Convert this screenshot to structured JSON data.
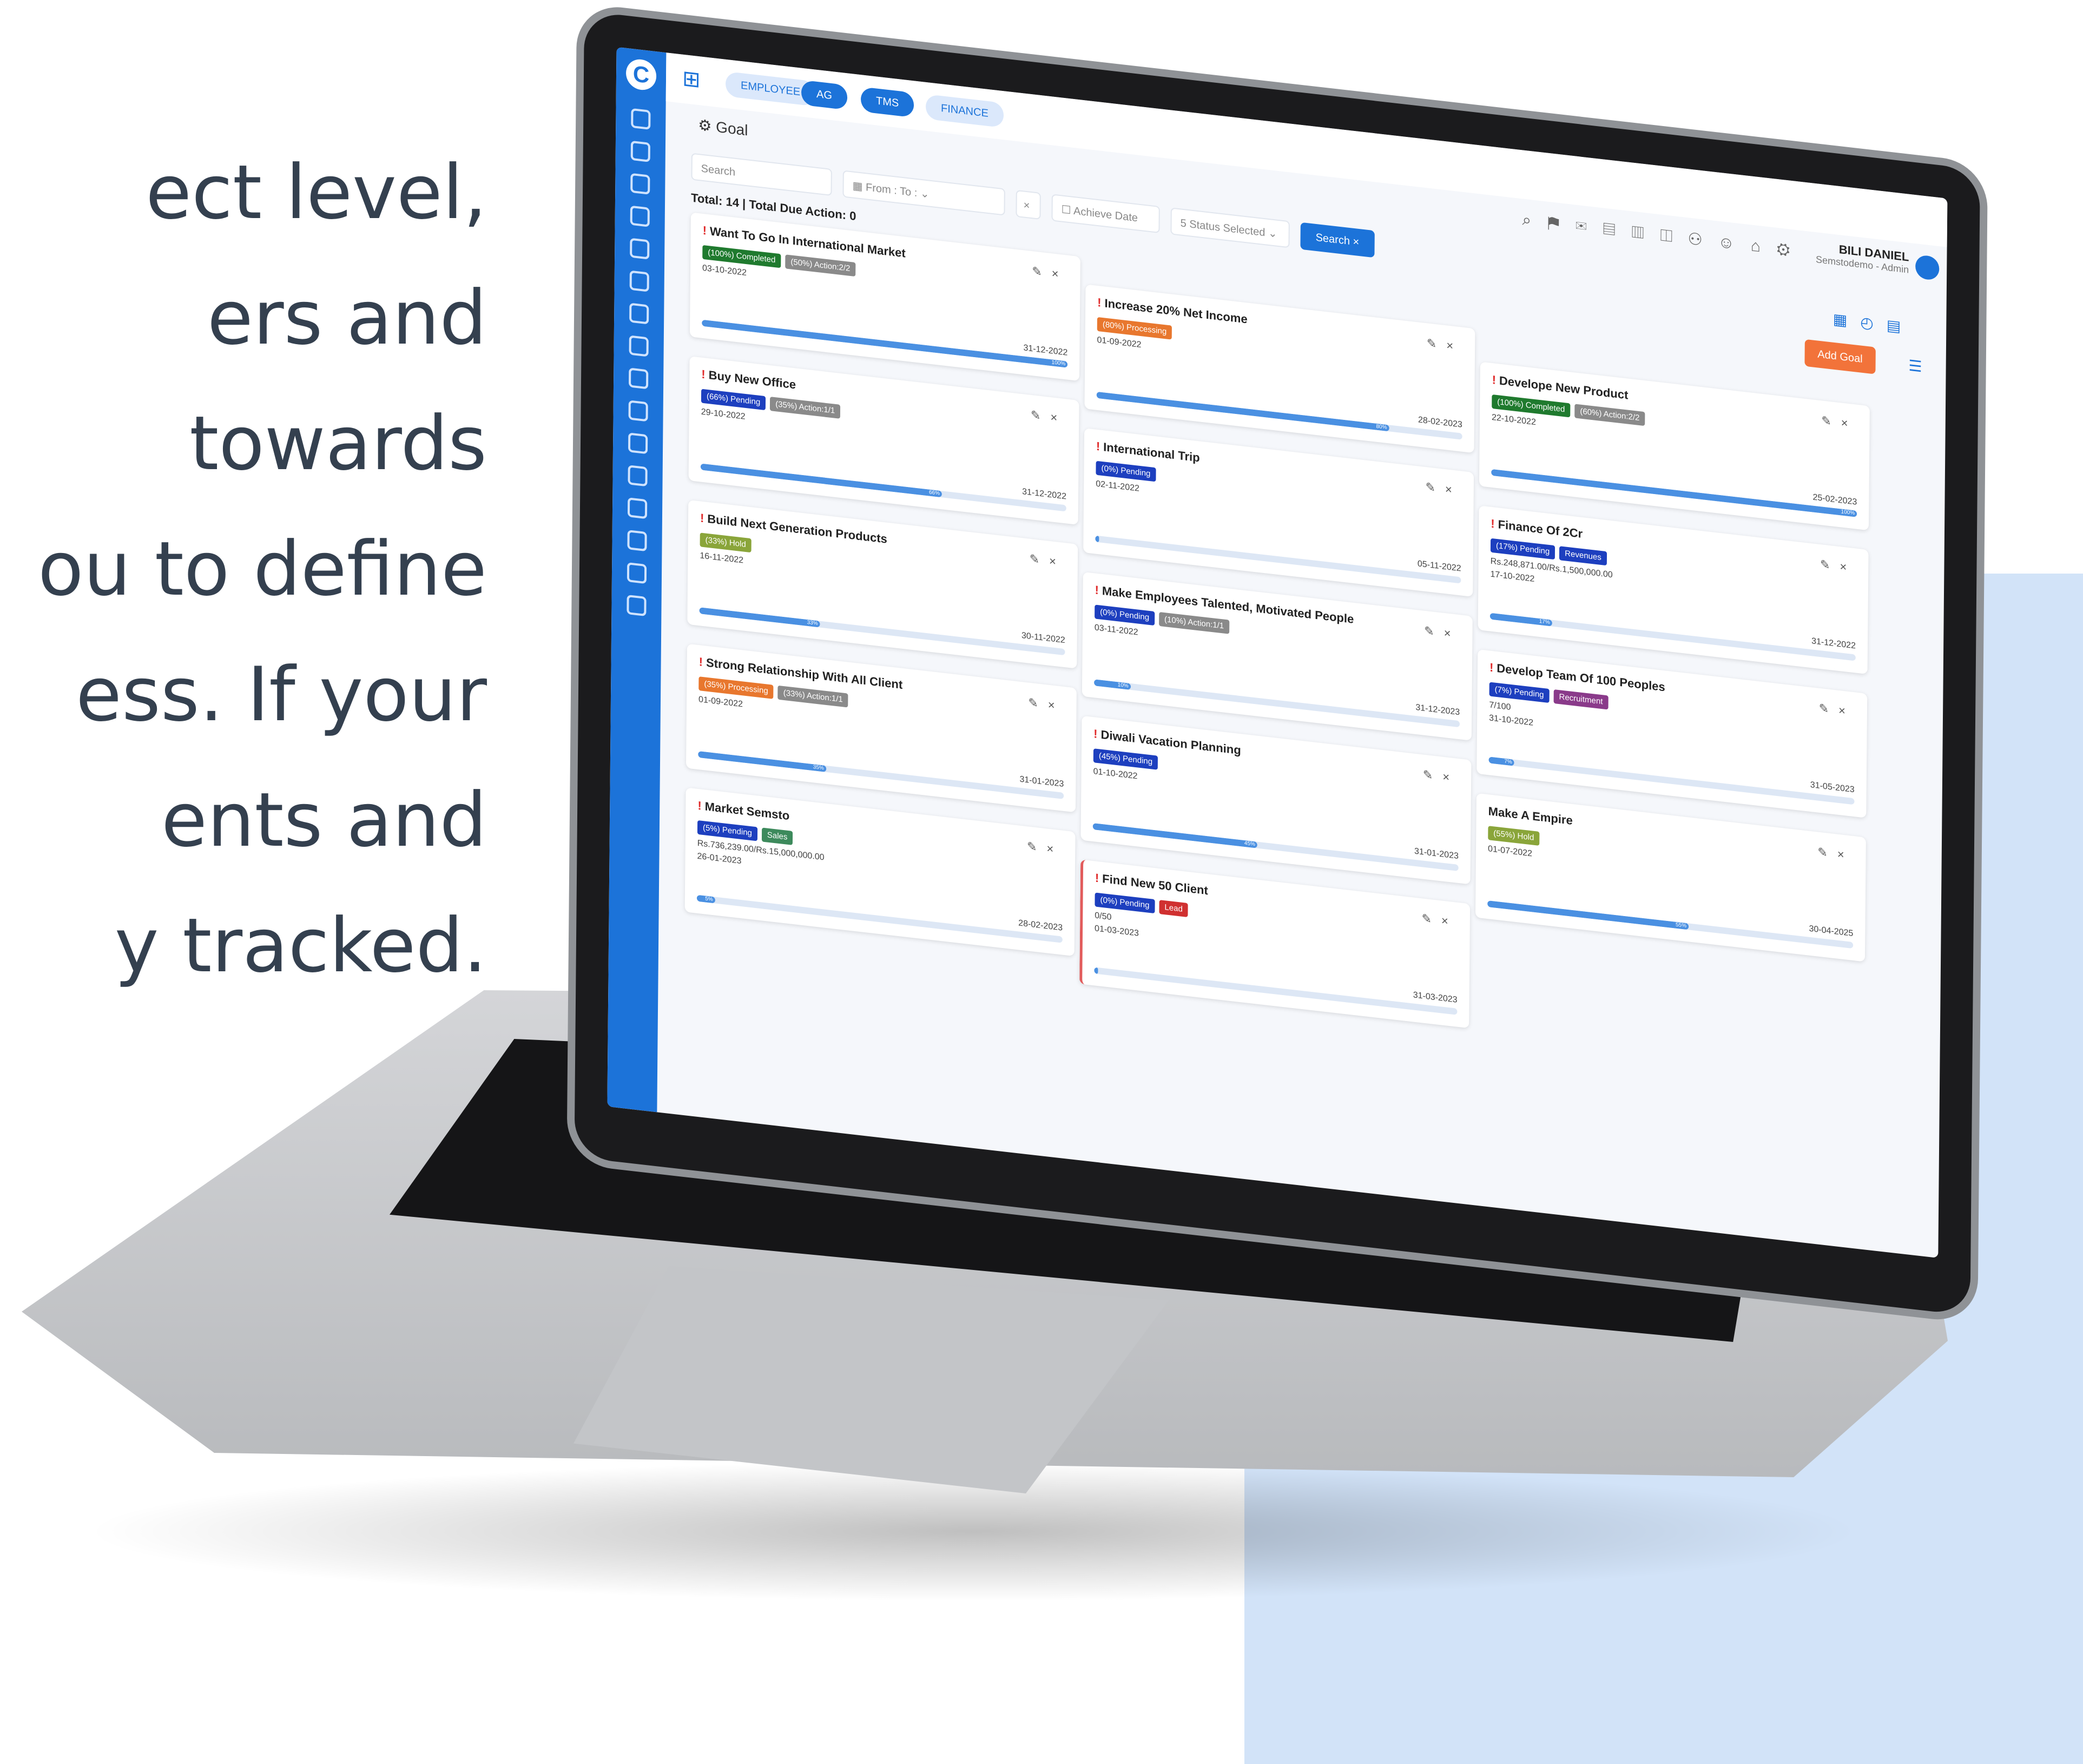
{
  "marketing": {
    "lines": [
      "ect level,",
      "ers and",
      " towards",
      "ou to define",
      "ess. If your",
      "ents and",
      "y tracked."
    ]
  },
  "colors": {
    "primary": "#1c73d9",
    "accent": "#f2733a",
    "danger": "#e02b2b"
  },
  "top_modules": [
    {
      "label": "EMPLOYEE",
      "active": false
    },
    {
      "label": "AG",
      "active": true
    },
    {
      "label": "TMS",
      "active": true
    },
    {
      "label": "FINANCE",
      "active": false
    }
  ],
  "page": {
    "title": "Goal"
  },
  "user": {
    "name": "BILI DANIEL",
    "role": "Semstodemo - Admin"
  },
  "filters": {
    "search_placeholder": "Search",
    "date_range": "From : To :",
    "clear": "×",
    "achieve_date": "Achieve Date",
    "status": "5 Status Selected",
    "search_button": "Search",
    "search_close": "×"
  },
  "summary": "Total: 14 | Total Due Action: 0",
  "add_goal": "Add Goal",
  "columns": [
    [
      {
        "title": "Want To Go In International Market",
        "badges": [
          {
            "text": "(100%) Completed",
            "color": "#1f7a2e"
          },
          {
            "text": "(50%) Action:2/2",
            "color": "#8a8a8a"
          }
        ],
        "extra": "",
        "start": "03-10-2022",
        "end": "31-12-2022",
        "progress": 100,
        "progress_label": "100%",
        "alert": true
      },
      {
        "title": "Buy New Office",
        "badges": [
          {
            "text": "(66%) Pending",
            "color": "#1d3fbf"
          },
          {
            "text": "(35%) Action:1/1",
            "color": "#8a8a8a"
          }
        ],
        "extra": "",
        "start": "29-10-2022",
        "end": "31-12-2022",
        "progress": 66,
        "progress_label": "66%",
        "alert": true
      },
      {
        "title": "Build Next Generation Products",
        "badges": [
          {
            "text": "(33%) Hold",
            "color": "#8aa53a"
          }
        ],
        "extra": "",
        "start": "16-11-2022",
        "end": "30-11-2022",
        "progress": 33,
        "progress_label": "33%",
        "alert": true
      },
      {
        "title": "Strong Relationship With All Client",
        "badges": [
          {
            "text": "(35%) Processing",
            "color": "#e8772e"
          },
          {
            "text": "(33%) Action:1/1",
            "color": "#8a8a8a"
          }
        ],
        "extra": "",
        "start": "01-09-2022",
        "end": "31-01-2023",
        "progress": 35,
        "progress_label": "35%",
        "alert": true
      },
      {
        "title": "Market Semsto",
        "badges": [
          {
            "text": "(5%) Pending",
            "color": "#1d3fbf"
          },
          {
            "text": "Sales",
            "color": "#3d8a5c"
          }
        ],
        "extra": "Rs.736,239.00/Rs.15,000,000.00",
        "start": "26-01-2023",
        "end": "28-02-2023",
        "progress": 5,
        "progress_label": "5%",
        "alert": true
      }
    ],
    [
      {
        "title": "Increase 20% Net Income",
        "badges": [
          {
            "text": "(80%) Processing",
            "color": "#e8772e"
          }
        ],
        "extra": "",
        "start": "01-09-2022",
        "end": "28-02-2023",
        "progress": 80,
        "progress_label": "80%",
        "alert": true
      },
      {
        "title": "International Trip",
        "badges": [
          {
            "text": "(0%) Pending",
            "color": "#1d3fbf"
          }
        ],
        "extra": "",
        "start": "02-11-2022",
        "end": "05-11-2022",
        "progress": 1,
        "progress_label": "",
        "alert": true
      },
      {
        "title": "Make Employees Talented, Motivated People",
        "badges": [
          {
            "text": "(0%) Pending",
            "color": "#1d3fbf"
          },
          {
            "text": "(10%) Action:1/1",
            "color": "#8a8a8a"
          }
        ],
        "extra": "",
        "start": "03-11-2022",
        "end": "31-12-2023",
        "progress": 10,
        "progress_label": "10%",
        "alert": true
      },
      {
        "title": "Diwali Vacation Planning",
        "badges": [
          {
            "text": "(45%) Pending",
            "color": "#1d3fbf"
          }
        ],
        "extra": "",
        "start": "01-10-2022",
        "end": "31-01-2023",
        "progress": 45,
        "progress_label": "45%",
        "alert": true
      },
      {
        "title": "Find New 50 Client",
        "badges": [
          {
            "text": "(0%) Pending",
            "color": "#1d3fbf"
          },
          {
            "text": "Lead",
            "color": "#d03030"
          }
        ],
        "extra": "0/50",
        "start": "01-03-2023",
        "end": "31-03-2023",
        "progress": 1,
        "progress_label": "",
        "alert": true
      }
    ],
    [
      {
        "title": "Develope New Product",
        "badges": [
          {
            "text": "(100%) Completed",
            "color": "#1f7a2e"
          },
          {
            "text": "(60%) Action:2/2",
            "color": "#8a8a8a"
          }
        ],
        "extra": "",
        "start": "22-10-2022",
        "end": "25-02-2023",
        "progress": 100,
        "progress_label": "100%",
        "alert": true
      },
      {
        "title": "Finance Of 2Cr",
        "badges": [
          {
            "text": "(17%) Pending",
            "color": "#1d3fbf"
          },
          {
            "text": "Revenues",
            "color": "#1d3fbf"
          }
        ],
        "extra": "Rs.248,871.00/Rs.1,500,000.00",
        "start": "17-10-2022",
        "end": "31-12-2022",
        "progress": 17,
        "progress_label": "17%",
        "alert": true
      },
      {
        "title": "Develop Team Of 100 Peoples",
        "badges": [
          {
            "text": "(7%) Pending",
            "color": "#1d3fbf"
          },
          {
            "text": "Recruitment",
            "color": "#8a3a8a"
          }
        ],
        "extra": "7/100",
        "start": "31-10-2022",
        "end": "31-05-2023",
        "progress": 7,
        "progress_label": "7%",
        "alert": true
      },
      {
        "title": "Make A Empire",
        "badges": [
          {
            "text": "(55%) Hold",
            "color": "#8aa53a"
          }
        ],
        "extra": "",
        "start": "01-07-2022",
        "end": "30-04-2025",
        "progress": 55,
        "progress_label": "55%",
        "alert": false
      }
    ]
  ]
}
